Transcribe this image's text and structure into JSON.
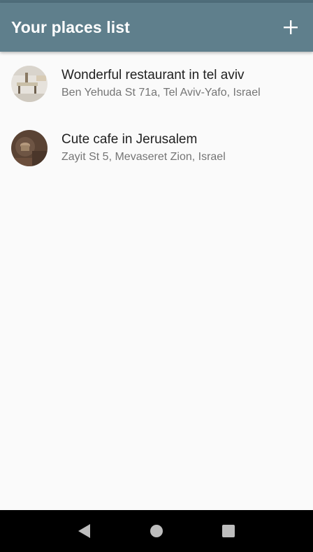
{
  "app_bar": {
    "title": "Your places list",
    "add_icon": "plus-icon",
    "background": "#5f7f8c"
  },
  "places": [
    {
      "title": "Wonderful restaurant in tel aviv",
      "address": "Ben Yehuda St 71a, Tel Aviv-Yafo, Israel",
      "image_icon": "restaurant-thumbnail"
    },
    {
      "title": "Cute cafe in Jerusalem",
      "address": "Zayit St 5, Mevaseret Zion, Israel",
      "image_icon": "cafe-thumbnail"
    }
  ],
  "nav_bar": {
    "back_icon": "back-triangle-icon",
    "home_icon": "home-circle-icon",
    "recents_icon": "recents-square-icon"
  }
}
